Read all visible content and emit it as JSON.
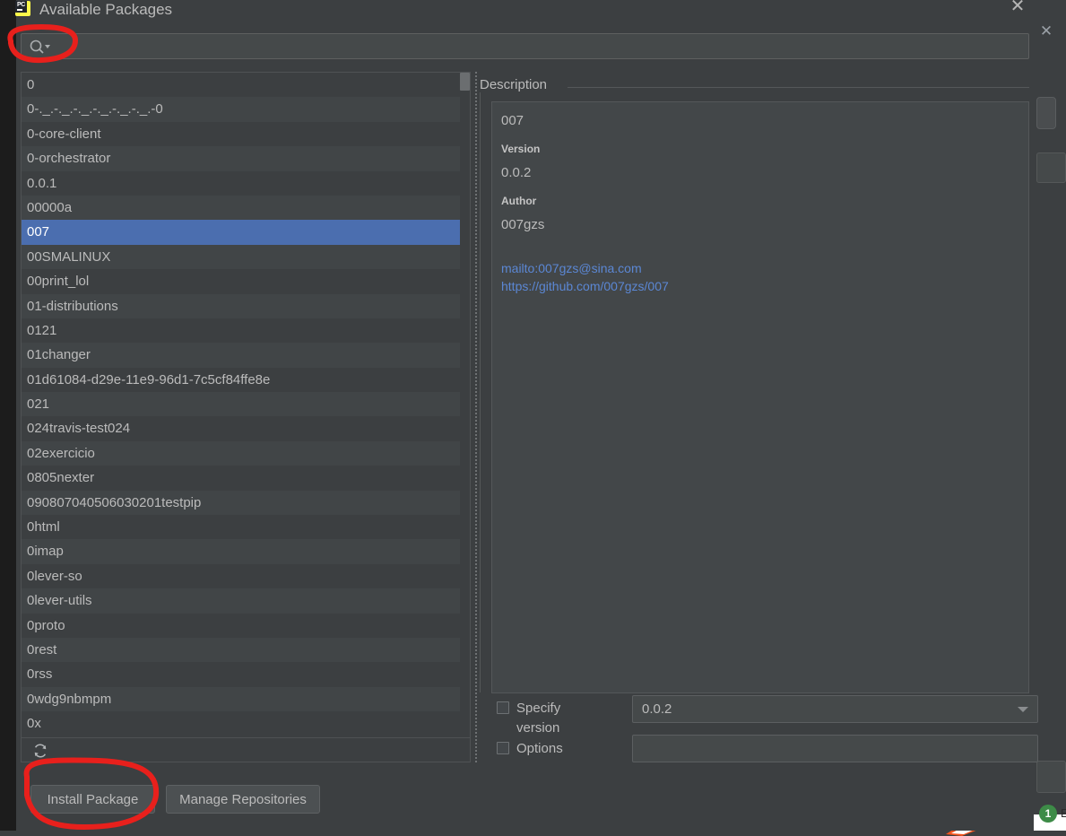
{
  "window": {
    "title": "Available Packages",
    "app_icon": "pycharm-icon",
    "icon_text": "PC",
    "close_label": "✕"
  },
  "search": {
    "value": "",
    "placeholder": "",
    "icon": "search-icon"
  },
  "packages": {
    "items": [
      "0",
      "0-._.-._.-._.-._.-._.-._.-0",
      "0-core-client",
      "0-orchestrator",
      "0.0.1",
      "00000a",
      "007",
      "00SMALINUX",
      "00print_lol",
      "01-distributions",
      "0121",
      "01changer",
      "01d61084-d29e-11e9-96d1-7c5cf84ffe8e",
      "021",
      "024travis-test024",
      "02exercicio",
      "0805nexter",
      "090807040506030201testpip",
      "0html",
      "0imap",
      "0lever-so",
      "0lever-utils",
      "0proto",
      "0rest",
      "0rss",
      "0wdg9nbmpm",
      "0x"
    ],
    "selected_index": 6,
    "selected": "007"
  },
  "list_toolbar": {
    "refresh_icon": "refresh-icon"
  },
  "description": {
    "legend": "Description",
    "package_name": "007",
    "version_label": "Version",
    "version_value": "0.0.2",
    "author_label": "Author",
    "author_value": "007gzs",
    "links": [
      "mailto:007gzs@sina.com",
      "https://github.com/007gzs/007"
    ]
  },
  "controls": {
    "specify_version_label": "Specify version",
    "specify_version_checked": false,
    "version_selected": "0.0.2",
    "options_label": "Options",
    "options_checked": false,
    "options_value": "",
    "options_placeholder": ""
  },
  "buttons": {
    "install": "Install Package",
    "manage": "Manage Repositories"
  },
  "background": {
    "close_label": "✕",
    "badge_count": "1",
    "badge_letter": "E"
  },
  "colors": {
    "dialog_bg": "#3c3f41",
    "row_even": "#3c3f41",
    "row_odd": "#414547",
    "selection": "#4b6eaf",
    "text": "#bbbbbb",
    "link": "#5b87d4",
    "annotation": "#e8201c",
    "badge_green": "#3d8b47",
    "marker_orange": "#f4541d"
  }
}
